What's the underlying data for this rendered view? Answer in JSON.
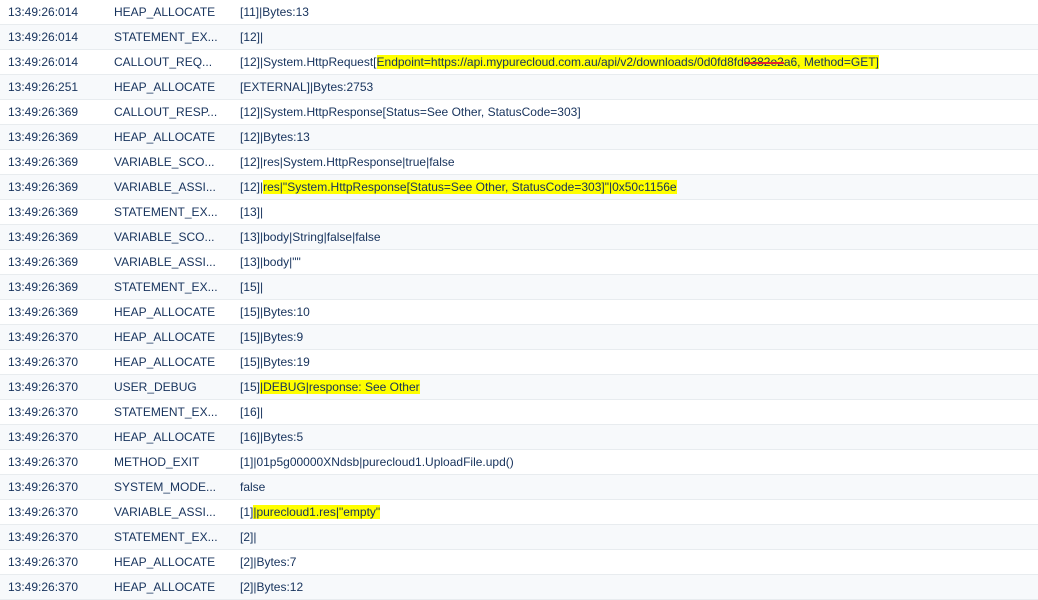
{
  "rows": [
    {
      "time": "13:49:26:014",
      "event": "HEAP_ALLOCATE",
      "pre": "[11]|Bytes:13"
    },
    {
      "time": "13:49:26:014",
      "event": "STATEMENT_EX...",
      "pre": "[12]|"
    },
    {
      "time": "13:49:26:014",
      "event": "CALLOUT_REQ...",
      "pre": "[12]|System.HttpRequest[",
      "hl": "Endpoint=https://api.mypurecloud.com.au/api/v2/downloads/0d0fd8fd",
      "strike": "9382e2",
      "hl2": "a6, Method=GET]"
    },
    {
      "time": "13:49:26:251",
      "event": "HEAP_ALLOCATE",
      "pre": "[EXTERNAL]|Bytes:2753"
    },
    {
      "time": "13:49:26:369",
      "event": "CALLOUT_RESP...",
      "pre": "[12]|System.HttpResponse[Status=See Other, StatusCode=303]"
    },
    {
      "time": "13:49:26:369",
      "event": "HEAP_ALLOCATE",
      "pre": "[12]|Bytes:13"
    },
    {
      "time": "13:49:26:369",
      "event": "VARIABLE_SCO...",
      "pre": "[12]|res|System.HttpResponse|true|false"
    },
    {
      "time": "13:49:26:369",
      "event": "VARIABLE_ASSI...",
      "pre": "[12]|",
      "hl": "res|\"System.HttpResponse[Status=See Other, StatusCode=303]\"|0x50c1156e"
    },
    {
      "time": "13:49:26:369",
      "event": "STATEMENT_EX...",
      "pre": "[13]|"
    },
    {
      "time": "13:49:26:369",
      "event": "VARIABLE_SCO...",
      "pre": "[13]|body|String|false|false"
    },
    {
      "time": "13:49:26:369",
      "event": "VARIABLE_ASSI...",
      "pre": "[13]|body|\"\""
    },
    {
      "time": "13:49:26:369",
      "event": "STATEMENT_EX...",
      "pre": "[15]|"
    },
    {
      "time": "13:49:26:369",
      "event": "HEAP_ALLOCATE",
      "pre": "[15]|Bytes:10"
    },
    {
      "time": "13:49:26:370",
      "event": "HEAP_ALLOCATE",
      "pre": "[15]|Bytes:9"
    },
    {
      "time": "13:49:26:370",
      "event": "HEAP_ALLOCATE",
      "pre": "[15]|Bytes:19"
    },
    {
      "time": "13:49:26:370",
      "event": "USER_DEBUG",
      "pre": "[15]",
      "hl": "|DEBUG|response: See Other"
    },
    {
      "time": "13:49:26:370",
      "event": "STATEMENT_EX...",
      "pre": "[16]|"
    },
    {
      "time": "13:49:26:370",
      "event": "HEAP_ALLOCATE",
      "pre": "[16]|Bytes:5"
    },
    {
      "time": "13:49:26:370",
      "event": "METHOD_EXIT",
      "pre": "[1]|01p5g00000XNdsb|purecloud1.UploadFile.upd()"
    },
    {
      "time": "13:49:26:370",
      "event": "SYSTEM_MODE...",
      "pre": "false"
    },
    {
      "time": "13:49:26:370",
      "event": "VARIABLE_ASSI...",
      "pre": "[1]",
      "hl": "|purecloud1.res|\"empty\""
    },
    {
      "time": "13:49:26:370",
      "event": "STATEMENT_EX...",
      "pre": "[2]|"
    },
    {
      "time": "13:49:26:370",
      "event": "HEAP_ALLOCATE",
      "pre": "[2]|Bytes:7"
    },
    {
      "time": "13:49:26:370",
      "event": "HEAP_ALLOCATE",
      "pre": "[2]|Bytes:12"
    }
  ]
}
